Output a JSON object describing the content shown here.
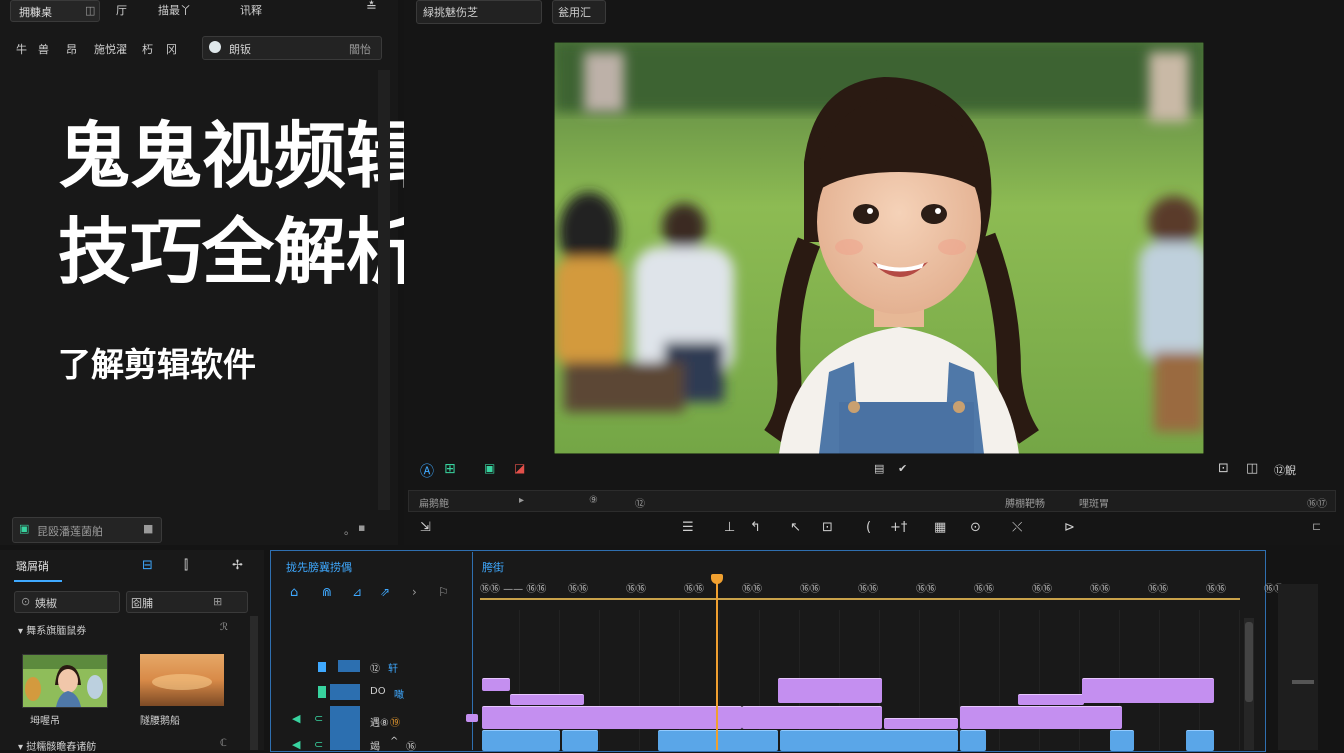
{
  "topbar": {
    "left_tab": "拥糠桌",
    "menu": [
      "厅",
      "描最丫",
      "讯释"
    ],
    "right_tab": "緑挑魅伤芝",
    "right_btn": "瓮用汇"
  },
  "media_toolbar": {
    "search_label": "朗钣",
    "right_label": "闇怡",
    "items": [
      "牛",
      "兽",
      "昂",
      "施悦濯",
      "朽",
      "冈"
    ]
  },
  "overlay": {
    "title_line1": "鬼鬼视频辑”",
    "title_line2": "技巧全解析",
    "subtitle": "了解剪辑软件"
  },
  "left_status": {
    "label": "昆殴潘莲菌舶",
    "right": "。"
  },
  "preview": {
    "image_desc_label": "",
    "controls_left": [
      "Ⓐ",
      "⊞",
      "▣",
      "◪"
    ],
    "controls_mid": [
      "▤",
      "✔"
    ],
    "controls_right": [
      "⊡",
      "◫",
      "⑫觬"
    ]
  },
  "scrubber": {
    "labels": [
      "扁鹅鲍",
      "▸",
      "⑨",
      "⑫",
      "膊棚靶畅",
      "哩斑胃",
      "⑯⑰"
    ]
  },
  "tools": [
    "☰",
    "⊥",
    "↰",
    "↖",
    "⊡",
    "(",
    "+†",
    "▦",
    "⊙",
    "⤬",
    "⊳"
  ],
  "media_panel": {
    "tab": "璐屑硝",
    "search": "姨椒",
    "filter": "囵脯",
    "section1": "▾ 舞系旗腼鼠券",
    "section1_right": "ℛ",
    "thumbs": [
      {
        "label": "坶喔吊"
      },
      {
        "label": "隧腰鹅船"
      }
    ],
    "section2": "▾ 挝糯骸瞻舂诸舫",
    "section2_right": "ℂ"
  },
  "timeline": {
    "header_left": "拢先膀冀捞偶",
    "header_right": "胯街",
    "timecodes": [
      "⑯⑯ —— ⑯⑯",
      "⑯⑯",
      "⑯⑯",
      "⑯⑯",
      "⑯⑯",
      "⑯⑯",
      "⑯⑯",
      "⑯⑯",
      "⑯⑯",
      "⑯⑯",
      "⑯⑯",
      "⑯⑯",
      "⑯⑯",
      "⑯⑯"
    ],
    "track_labels": [
      {
        "name": "⑫",
        "tag": "轩"
      },
      {
        "name": "DO",
        "tag": "噉"
      },
      {
        "name": "遇⑧",
        "tag": "⑲"
      },
      {
        "name": "竭",
        "tag": "⑯"
      }
    ]
  },
  "colors": {
    "accent_blue": "#3fa9ff",
    "playhead": "#f0a030",
    "clip_purple": "#c48ff0",
    "clip_blue": "#5aa6e8"
  }
}
